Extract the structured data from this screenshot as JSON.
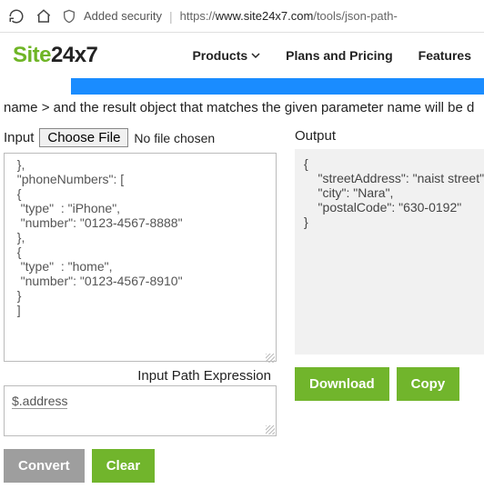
{
  "browser": {
    "added_security": "Added security",
    "url_prefix": "https://",
    "url_host": "www.site24x7.com",
    "url_path": "/tools/json-path-"
  },
  "logo": {
    "green": "Site",
    "dark": "24x7"
  },
  "nav": {
    "products": "Products",
    "plans": "Plans and Pricing",
    "features": "Features"
  },
  "desc": "name > and the result object that matches the given parameter name will be d",
  "input": {
    "label": "Input",
    "choose": "Choose File",
    "no_file": "No file chosen",
    "text": "  },\n  \"phoneNumbers\": [\n  {\n   \"type\"  : \"iPhone\",\n   \"number\": \"0123-4567-8888\"\n  },\n  {\n   \"type\"  : \"home\",\n   \"number\": \"0123-4567-8910\"\n  }\n  ]",
    "path_label": "Input Path Expression",
    "path_value": "$.address"
  },
  "output": {
    "label": "Output",
    "text": "{\n    \"streetAddress\": \"naist street\",\n    \"city\": \"Nara\",\n    \"postalCode\": \"630-0192\"\n}"
  },
  "buttons": {
    "convert": "Convert",
    "clear": "Clear",
    "download": "Download",
    "copy": "Copy"
  }
}
